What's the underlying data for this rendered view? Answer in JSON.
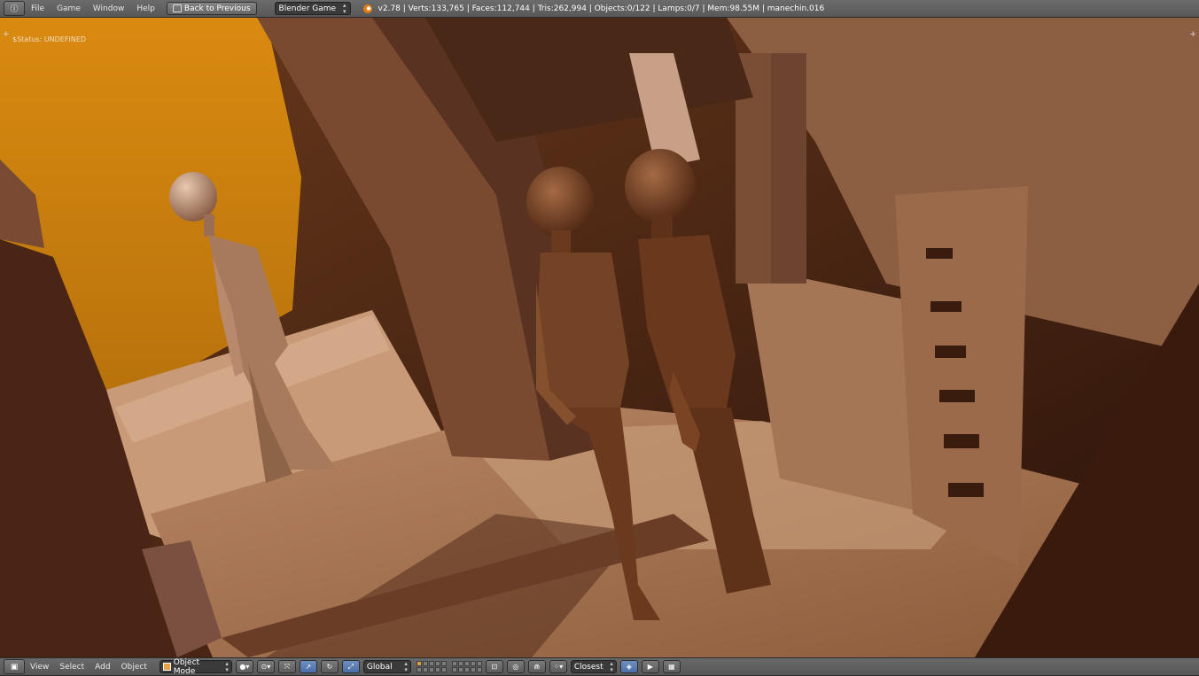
{
  "topbar": {
    "editor_icon": "info-icon",
    "menus": [
      "File",
      "Game",
      "Window",
      "Help"
    ],
    "back_button": "Back to Previous",
    "render_engine": "Blender Game",
    "stats": "v2.78 | Verts:133,765 | Faces:112,744 | Tris:262,994 | Objects:0/122 | Lamps:0/7 | Mem:98.55M | manechin.016"
  },
  "viewport": {
    "status_text": "$Status: UNDEFINED",
    "plus_glyph": "+"
  },
  "bottombar": {
    "editor_icon": "3d-view-icon",
    "menus": [
      "View",
      "Select",
      "Add",
      "Object"
    ],
    "mode": "Object Mode",
    "orientation": "Global",
    "snap_target": "Closest"
  },
  "colors": {
    "bar_bg": "#626262",
    "accent_orange": "#c9800f",
    "scene_warm": "#a86a3c",
    "scene_dark": "#3a1a10"
  }
}
